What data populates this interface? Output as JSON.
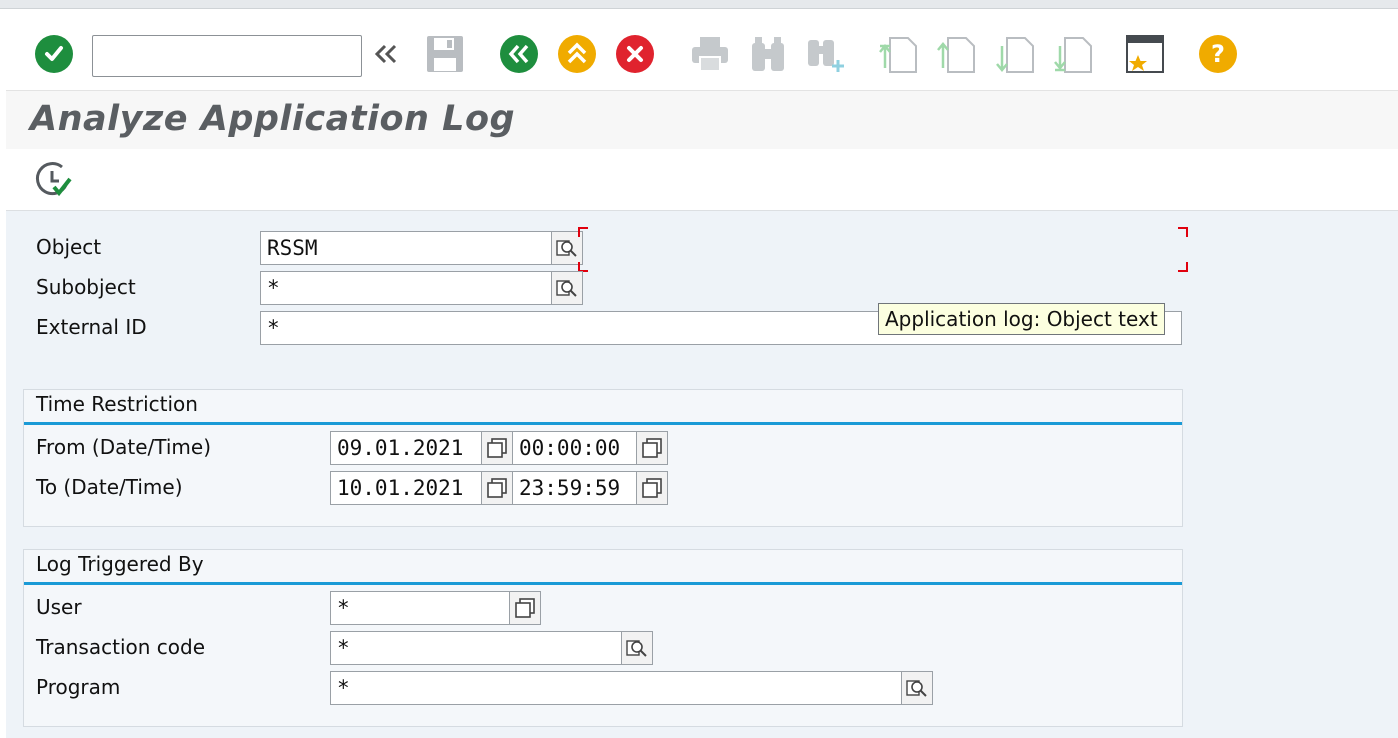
{
  "toolbar": {
    "command_field_value": "",
    "icons": [
      "check-icon",
      "expand-icon",
      "save-icon",
      "back-icon",
      "exit-icon",
      "cancel-icon",
      "print-icon",
      "find-icon",
      "find-next-icon",
      "first-page-icon",
      "previous-page-icon",
      "next-page-icon",
      "last-page-icon",
      "create-shortcut-icon",
      "help-icon"
    ]
  },
  "page": {
    "title": "Analyze Application Log"
  },
  "app_toolbar": {
    "icons": [
      "execute-icon"
    ]
  },
  "form": {
    "object_label": "Object",
    "object_value": "RSSM",
    "subobject_label": "Subobject",
    "subobject_value": "*",
    "external_id_label": "External ID",
    "external_id_value": "*"
  },
  "tooltip": "Application log: Object text",
  "time_restriction": {
    "title": "Time Restriction",
    "from_label": "From (Date/Time)",
    "from_date": "09.01.2021",
    "from_time": "00:00:00",
    "to_label": "To (Date/Time)",
    "to_date": "10.01.2021",
    "to_time": "23:59:59"
  },
  "log_triggered_by": {
    "title": "Log Triggered By",
    "user_label": "User",
    "user_value": "*",
    "tcode_label": "Transaction code",
    "tcode_value": "*",
    "program_label": "Program",
    "program_value": "*"
  },
  "colors": {
    "accent_line": "#1a9ad6",
    "check_green": "#1e8e3e",
    "cancel_red": "#e0232e",
    "exit_yellow": "#f0ab00"
  }
}
